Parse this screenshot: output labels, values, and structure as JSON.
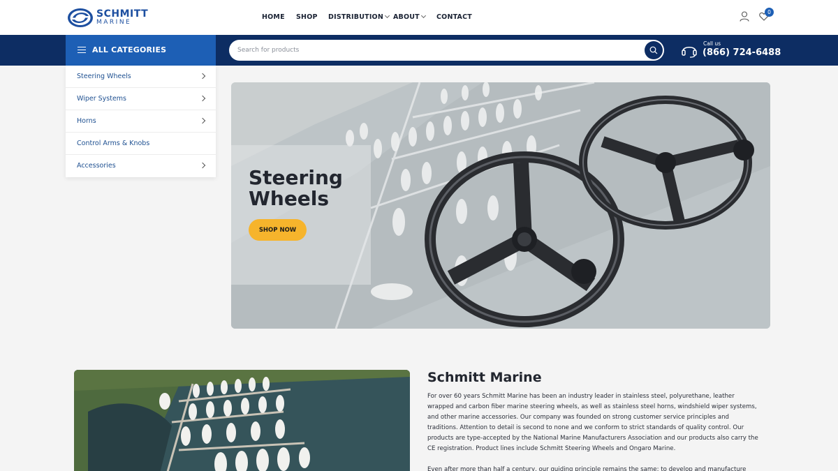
{
  "brand": {
    "name_line1": "SCHMITT",
    "name_line2": "MARINE",
    "primary_color": "#1d5fb5",
    "dark_color": "#0d2d63",
    "accent_color": "#f6b42c"
  },
  "nav": {
    "home": "HOME",
    "shop": "SHOP",
    "distribution": "DISTRIBUTION",
    "about": "ABOUT",
    "contact": "CONTACT"
  },
  "header_icons": {
    "account": "user-icon",
    "wishlist": "heart-icon",
    "wishlist_count": "0"
  },
  "categories_bar": {
    "label": "ALL CATEGORIES"
  },
  "search": {
    "placeholder": "Search for products",
    "value": ""
  },
  "contact": {
    "call_label": "Call us",
    "phone": "(866) 724-6488"
  },
  "categories": [
    {
      "label": "Steering Wheels",
      "has_children": true
    },
    {
      "label": "Wiper Systems",
      "has_children": true
    },
    {
      "label": "Horns",
      "has_children": true
    },
    {
      "label": "Control Arms & Knobs",
      "has_children": false
    },
    {
      "label": "Accessories",
      "has_children": true
    }
  ],
  "hero": {
    "title_line1": "Steering",
    "title_line2": "Wheels",
    "cta": "SHOP NOW"
  },
  "about": {
    "title": "Schmitt Marine",
    "paragraph1": "For over 60 years Schmitt Marine has been an industry leader in stainless steel, polyurethane, leather wrapped and carbon fiber marine steering wheels, as well as stainless steel horns, windshield wiper systems, and other marine accessories. Our company was founded on strong customer service principles and traditions. Attention to detail is second to none and we conform to strict standards of quality control. Our products are type-accepted by the National Marine Manufacturers Association and our products also carry the CE registration. Product lines include Schmitt Steering Wheels and Ongaro Marine.",
    "paragraph2": "Even after more than half a century, our guiding principle remains the same: to develop and manufacture"
  }
}
